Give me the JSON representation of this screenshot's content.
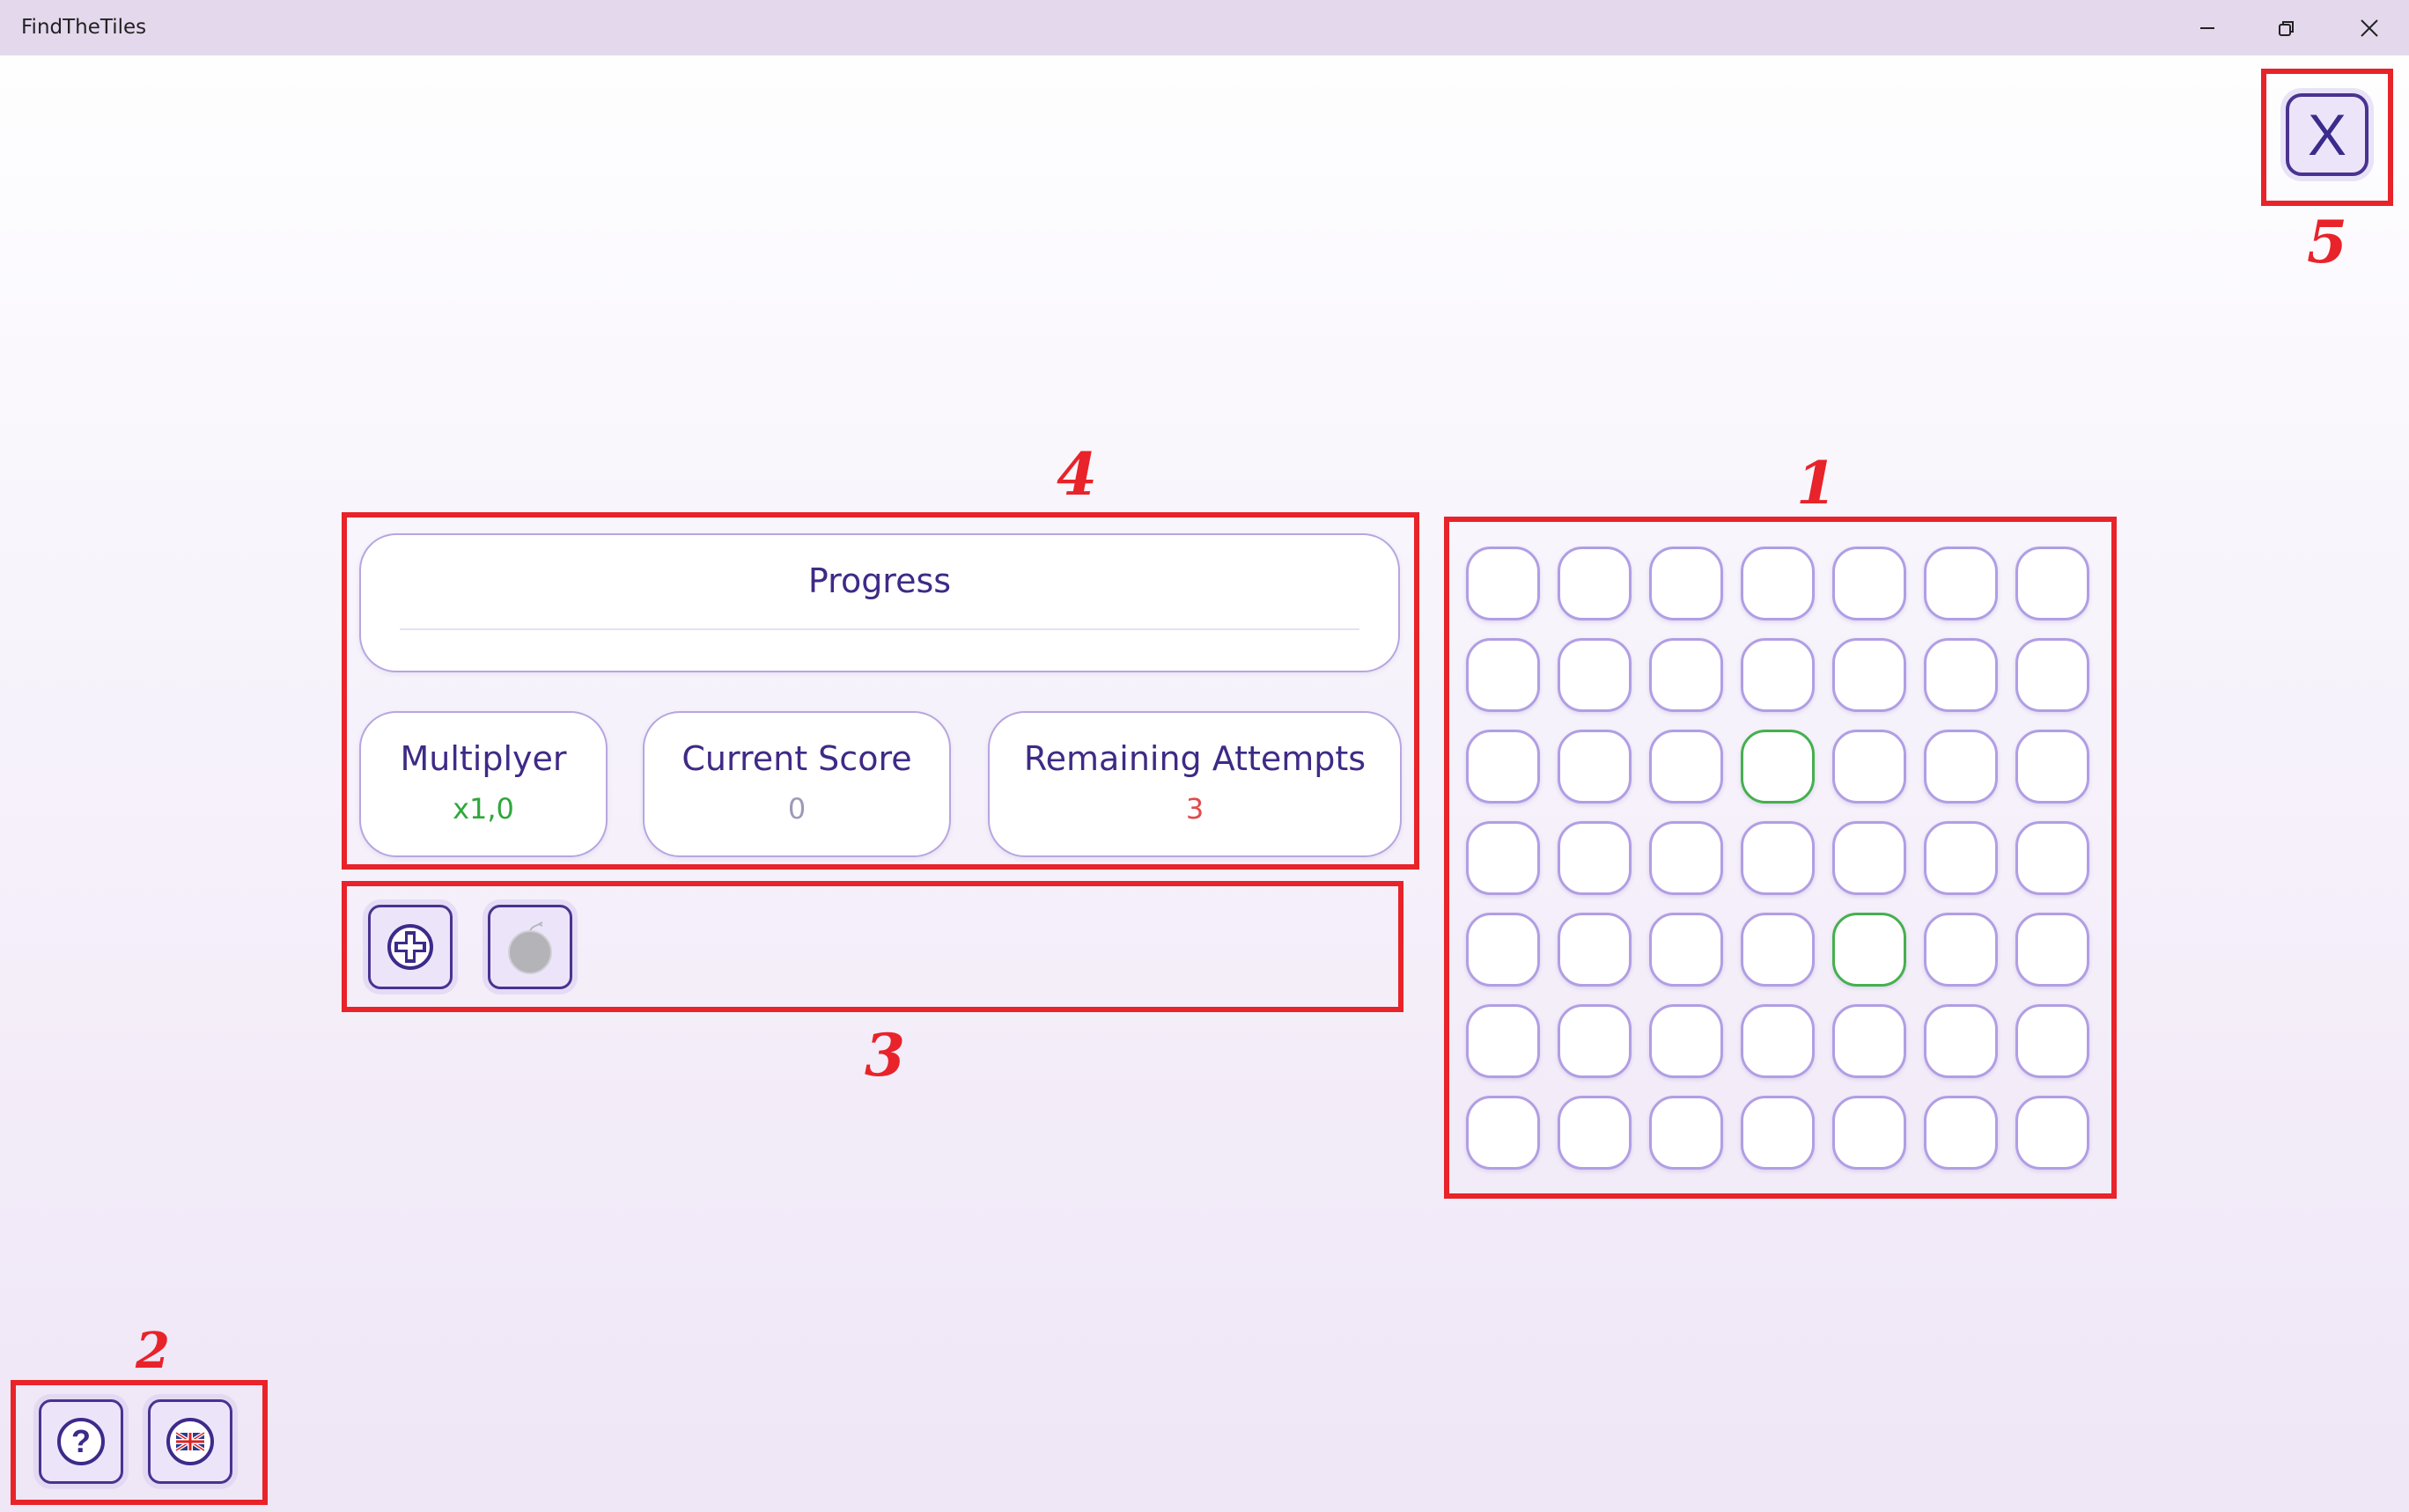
{
  "window": {
    "title": "FindTheTiles",
    "controls": [
      "minimize-icon",
      "restore-icon",
      "close-icon"
    ]
  },
  "close_button": {
    "label": "X"
  },
  "progress": {
    "title": "Progress"
  },
  "stats": {
    "multiplier": {
      "label": "Multiplyer",
      "value": "x1,0",
      "color": "#2ea83a"
    },
    "current_score": {
      "label": "Current Score",
      "value": "0",
      "color": "#a098b8"
    },
    "remaining_attempts": {
      "label": "Remaining Attempts",
      "value": "3",
      "color": "#e24a4a"
    }
  },
  "powerups": [
    {
      "icon": "plus-circle-icon",
      "enabled": true
    },
    {
      "icon": "bomb-icon",
      "enabled": false
    }
  ],
  "bottom_buttons": [
    {
      "icon": "help-icon",
      "glyph": "?"
    },
    {
      "icon": "uk-flag-icon"
    }
  ],
  "grid": {
    "rows": 7,
    "cols": 7,
    "revealed_tiles": [
      {
        "row": 2,
        "col": 3
      },
      {
        "row": 4,
        "col": 4
      }
    ],
    "revealed_color": "#45b04e"
  },
  "annotations": [
    "1",
    "2",
    "3",
    "4",
    "5"
  ]
}
